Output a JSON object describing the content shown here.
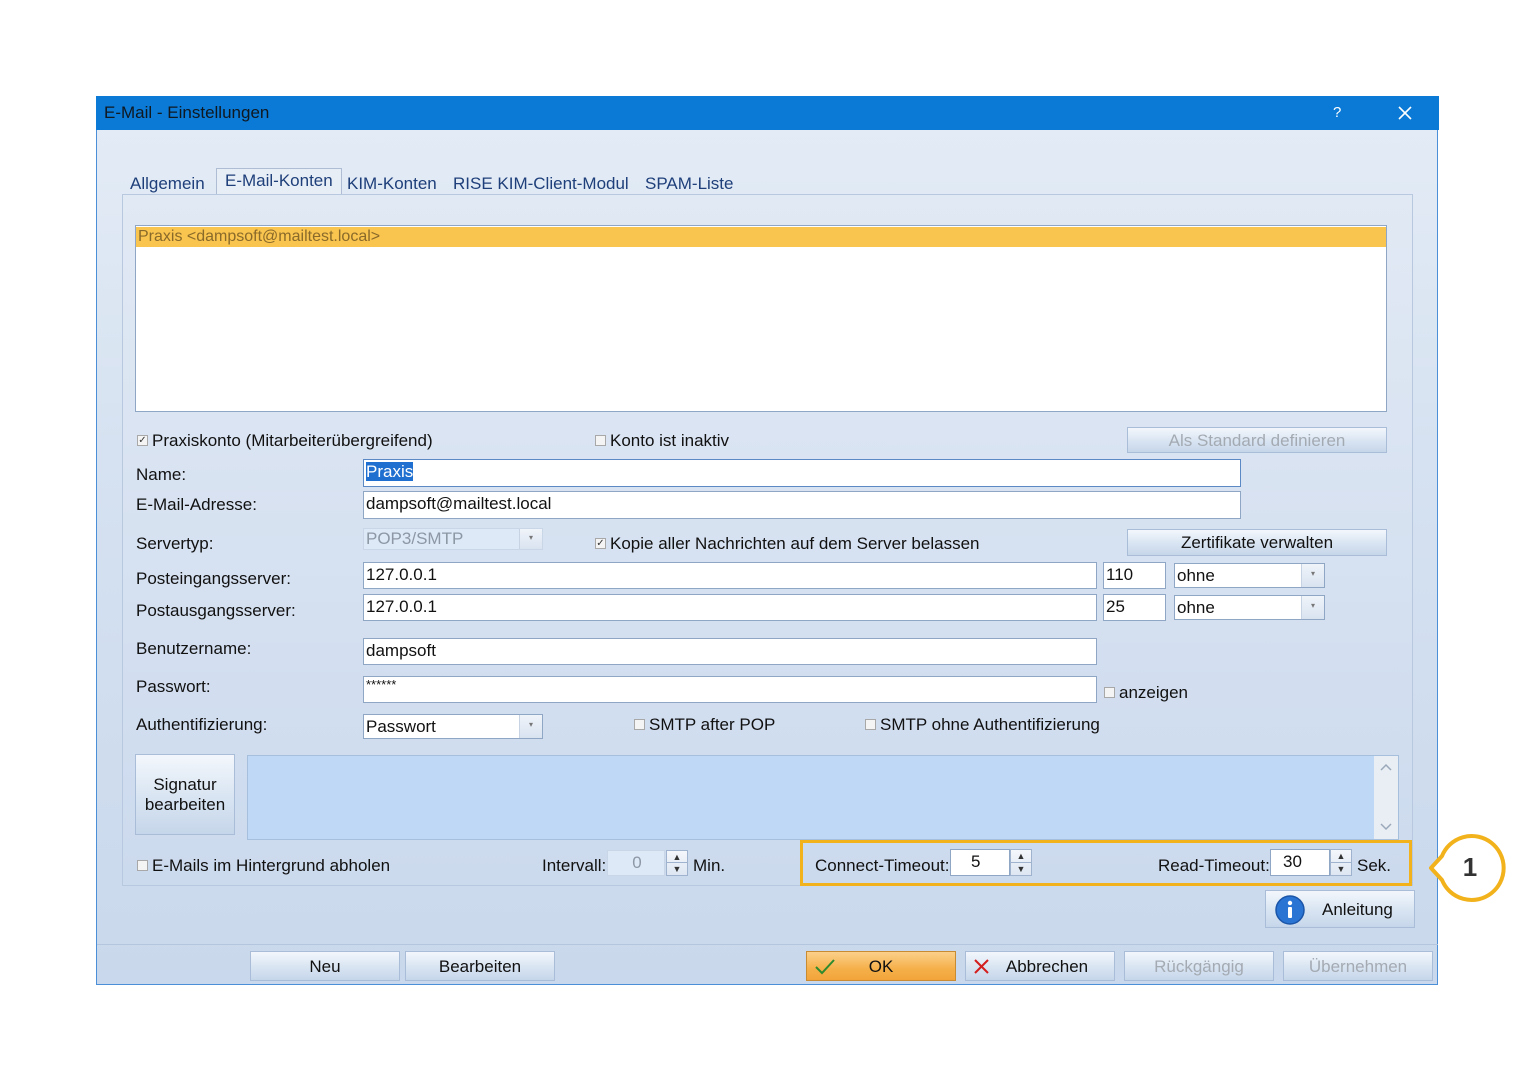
{
  "window": {
    "title": "E-Mail - Einstellungen",
    "help": "?",
    "close": "×"
  },
  "tabs": [
    {
      "label": "Allgemein"
    },
    {
      "label": "E-Mail-Konten"
    },
    {
      "label": "KIM-Konten"
    },
    {
      "label": "RISE KIM-Client-Modul"
    },
    {
      "label": "SPAM-Liste"
    }
  ],
  "accounts": [
    "Praxis <dampsoft@mailtest.local>"
  ],
  "form": {
    "praxiskonto_label": "Praxiskonto (Mitarbeiterübergreifend)",
    "praxiskonto_checked": "✓",
    "inaktiv_label": "Konto ist inaktiv",
    "standard_button": "Als Standard definieren",
    "name_label": "Name:",
    "name_value": "Praxis",
    "email_label": "E-Mail-Adresse:",
    "email_value": "dampsoft@mailtest.local",
    "servertyp_label": "Servertyp:",
    "servertyp_value": "POP3/SMTP",
    "kopie_label": "Kopie aller Nachrichten auf dem Server belassen",
    "kopie_checked": "✓",
    "zertifikate_button": "Zertifikate verwalten",
    "posteingang_label": "Posteingangsserver:",
    "posteingang_value": "127.0.0.1",
    "posteingang_port": "110",
    "posteingang_enc": "ohne",
    "postausgang_label": "Postausgangsserver:",
    "postausgang_value": "127.0.0.1",
    "postausgang_port": "25",
    "postausgang_enc": "ohne",
    "benutzer_label": "Benutzername:",
    "benutzer_value": "dampsoft",
    "passwort_label": "Passwort:",
    "passwort_value": "******",
    "anzeigen_label": "anzeigen",
    "auth_label": "Authentifizierung:",
    "auth_value": "Passwort",
    "smtp_after_pop_label": "SMTP after POP",
    "smtp_ohne_auth_label": "SMTP ohne Authentifizierung",
    "signatur_button_1": "Signatur",
    "signatur_button_2": "bearbeiten",
    "hintergrund_label": "E-Mails im Hintergrund abholen",
    "intervall_label": "Intervall:",
    "intervall_value": "0",
    "intervall_unit": "Min.",
    "connect_label": "Connect-Timeout:",
    "connect_value": "5",
    "read_label": "Read-Timeout:",
    "read_value": "30",
    "read_unit": "Sek.",
    "anleitung_button": "Anleitung"
  },
  "footer": {
    "neu": "Neu",
    "bearbeiten": "Bearbeiten",
    "ok": "OK",
    "abbrechen": "Abbrechen",
    "rueckgaengig": "Rückgängig",
    "uebernehmen": "Übernehmen"
  },
  "callout_number": "1",
  "colors": {
    "titlebar": "#0a7ad6",
    "selection": "#f9c54f",
    "highlight": "#f2b21c"
  }
}
